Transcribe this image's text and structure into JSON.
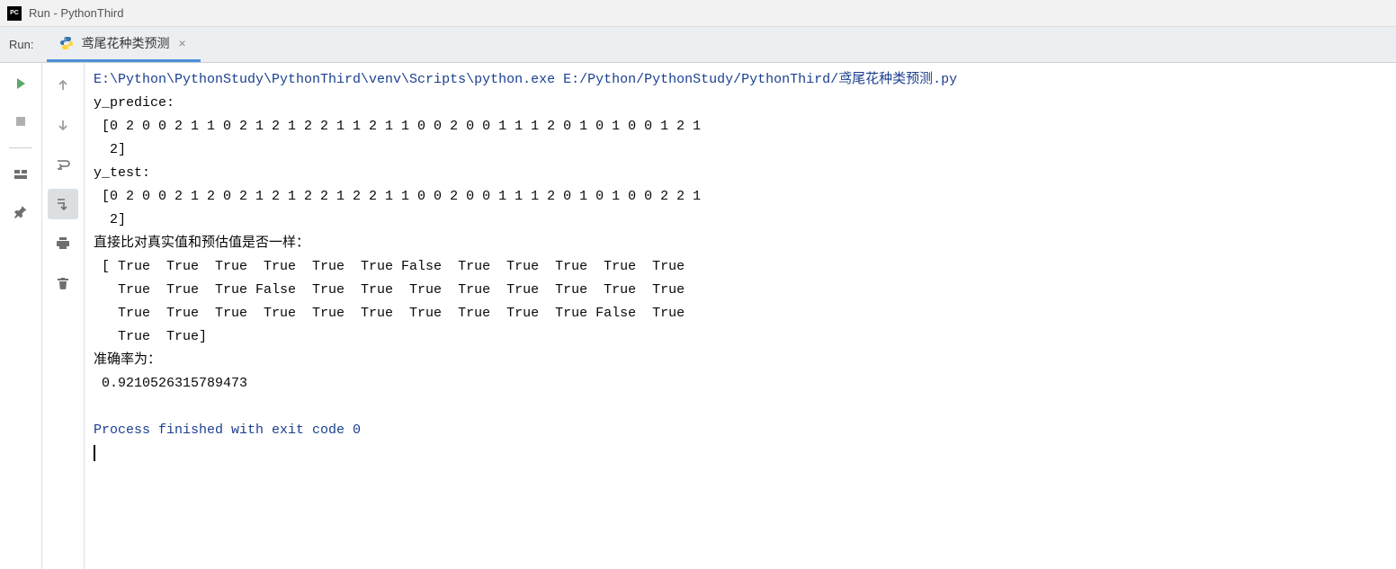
{
  "titlebar": {
    "app_icon_text": "PC",
    "title": "Run - PythonThird"
  },
  "header": {
    "run_label": "Run:",
    "tab": {
      "label": "鸢尾花种类预测"
    }
  },
  "console": {
    "command_line": "E:\\Python\\PythonStudy\\PythonThird\\venv\\Scripts\\python.exe E:/Python/PythonStudy/PythonThird/鸢尾花种类预测.py",
    "ypred_label": "y_predice:",
    "ypred_line1": " [0 2 0 0 2 1 1 0 2 1 2 1 2 2 1 1 2 1 1 0 0 2 0 0 1 1 1 2 0 1 0 1 0 0 1 2 1",
    "ypred_line2": "  2]",
    "ytest_label": "y_test:",
    "ytest_line1": " [0 2 0 0 2 1 2 0 2 1 2 1 2 2 1 2 2 1 1 0 0 2 0 0 1 1 1 2 0 1 0 1 0 0 2 2 1",
    "ytest_line2": "  2]",
    "compare_label": "直接比对真实值和预估值是否一样：",
    "cmp_line1": " [ True  True  True  True  True  True False  True  True  True  True  True",
    "cmp_line2": "   True  True  True False  True  True  True  True  True  True  True  True",
    "cmp_line3": "   True  True  True  True  True  True  True  True  True  True False  True",
    "cmp_line4": "   True  True]",
    "acc_label": "准确率为：",
    "acc_value": " 0.9210526315789473",
    "exit_line": "Process finished with exit code 0"
  }
}
